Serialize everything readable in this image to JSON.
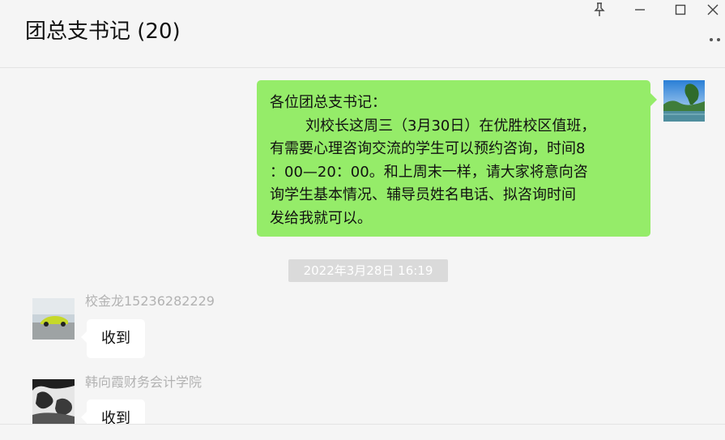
{
  "header": {
    "title": "团总支书记 (20)"
  },
  "window_controls": {
    "pin_icon": "pin-icon",
    "minimize_icon": "minimize-icon",
    "maximize_icon": "maximize-icon",
    "close_icon": "close-icon",
    "more_icon": "more-icon"
  },
  "messages": {
    "outgoing": {
      "lines": [
        "各位团总支书记：",
        "刘校长这周三（3月30日）在优胜校区值班，",
        "有需要心理咨询交流的学生可以预约咨询，时间8",
        "：00—20：00。和上周末一样，请大家将意向咨",
        "询学生基本情况、辅导员姓名电话、拟咨询时间",
        "发给我就可以。"
      ]
    },
    "timestamp": "2022年3月28日 16:19",
    "incoming": [
      {
        "sender": "校金龙15236282229",
        "text": "收到"
      },
      {
        "sender": "韩向霞财务会计学院",
        "text": "收到"
      }
    ]
  },
  "colors": {
    "outgoing_bubble": "#95ec69",
    "incoming_bubble": "#ffffff",
    "background": "#f5f5f5",
    "sender_name": "#b2b2b2",
    "timestamp_bg": "#dadada"
  }
}
